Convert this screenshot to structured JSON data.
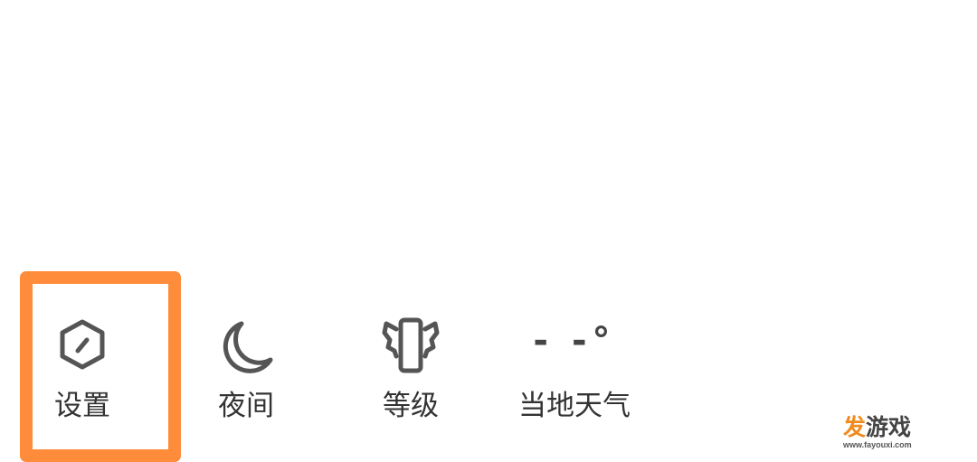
{
  "menu": {
    "settings": {
      "label": "设置",
      "icon": "hexagon-settings-icon"
    },
    "night": {
      "label": "夜间",
      "icon": "moon-icon"
    },
    "level": {
      "label": "等级",
      "icon": "winged-phone-icon"
    },
    "weather": {
      "label": "当地天气",
      "temperature": "- -°"
    }
  },
  "highlight": {
    "color": "#ff8c3a",
    "target": "settings"
  },
  "watermark": {
    "brand_part1": "发",
    "brand_part2": "游戏",
    "url": "www.fayouxi.com"
  },
  "colors": {
    "icon": "#555555",
    "label": "#333333",
    "highlight": "#ff8c3a",
    "brand_orange": "#f08a1c"
  }
}
